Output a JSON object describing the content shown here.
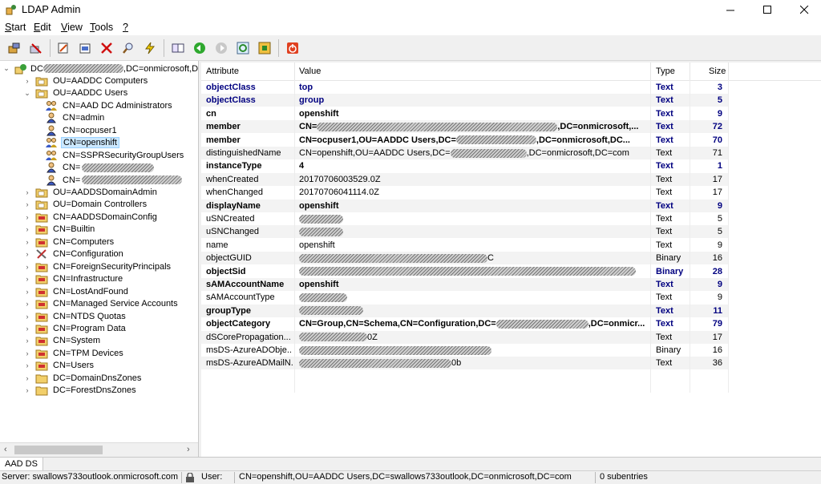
{
  "window": {
    "title": "LDAP Admin",
    "minimize": "—",
    "maximize": "☐",
    "close": "✕"
  },
  "menu": [
    {
      "label": "Start",
      "u": "S",
      "rest": "tart"
    },
    {
      "label": "Edit",
      "u": "E",
      "rest": "dit"
    },
    {
      "label": "View",
      "u": "V",
      "rest": "iew"
    },
    {
      "label": "Tools",
      "u": "T",
      "rest": "ools"
    },
    {
      "label": "?",
      "u": "?",
      "rest": ""
    }
  ],
  "toolbar_icons": [
    "connect-icon",
    "disconnect-icon",
    "edit-entry-icon",
    "properties-icon",
    "delete-icon",
    "search-icon",
    "quick-search-icon",
    "schema-icon",
    "back-icon",
    "forward-icon",
    "refresh-icon",
    "export-icon",
    "exit-icon"
  ],
  "tree": {
    "root": {
      "label_prefix": "DC",
      "label_suffix": ",DC=onmicrosoft,D"
    },
    "items": [
      {
        "label": "OU=AADDC Computers",
        "icon": "ou-folder-icon",
        "expanded": false
      },
      {
        "label": "OU=AADDC Users",
        "icon": "ou-folder-icon",
        "expanded": true
      },
      {
        "label": "CN=AAD DC Administrators",
        "icon": "group-icon",
        "child": true
      },
      {
        "label": "CN=admin",
        "icon": "user-icon",
        "child": true
      },
      {
        "label": "CN=ocpuser1",
        "icon": "user-icon",
        "child": true
      },
      {
        "label": "CN=openshift",
        "icon": "group-icon",
        "child": true,
        "selected": true
      },
      {
        "label": "CN=SSPRSecurityGroupUsers",
        "icon": "group-icon",
        "child": true
      },
      {
        "label": "CN=",
        "icon": "user-icon",
        "child": true,
        "redacted": 90
      },
      {
        "label": "CN=",
        "icon": "user-icon",
        "child": true,
        "redacted": 125
      },
      {
        "label": "OU=AADDSDomainAdmin",
        "icon": "ou-folder-icon"
      },
      {
        "label": "OU=Domain Controllers",
        "icon": "ou-folder-icon"
      },
      {
        "label": "CN=AADDSDomainConfig",
        "icon": "container-icon"
      },
      {
        "label": "CN=Builtin",
        "icon": "container-icon"
      },
      {
        "label": "CN=Computers",
        "icon": "container-icon"
      },
      {
        "label": "CN=Configuration",
        "icon": "config-icon"
      },
      {
        "label": "CN=ForeignSecurityPrincipals",
        "icon": "container-icon"
      },
      {
        "label": "CN=Infrastructure",
        "icon": "container-icon"
      },
      {
        "label": "CN=LostAndFound",
        "icon": "container-icon"
      },
      {
        "label": "CN=Managed Service Accounts",
        "icon": "container-icon"
      },
      {
        "label": "CN=NTDS Quotas",
        "icon": "container-icon"
      },
      {
        "label": "CN=Program Data",
        "icon": "container-icon"
      },
      {
        "label": "CN=System",
        "icon": "container-icon"
      },
      {
        "label": "CN=TPM Devices",
        "icon": "container-icon"
      },
      {
        "label": "CN=Users",
        "icon": "container-icon"
      },
      {
        "label": "DC=DomainDnsZones",
        "icon": "folder-icon"
      },
      {
        "label": "DC=ForestDnsZones",
        "icon": "folder-icon"
      }
    ]
  },
  "grid": {
    "headers": {
      "attribute": "Attribute",
      "value": "Value",
      "type": "Type",
      "size": "Size"
    },
    "rows": [
      {
        "attr": "objectClass",
        "value": "top",
        "type": "Text",
        "size": "3",
        "style": "oc"
      },
      {
        "attr": "objectClass",
        "value": "group",
        "type": "Text",
        "size": "5",
        "style": "oc"
      },
      {
        "attr": "cn",
        "value": "openshift",
        "type": "Text",
        "size": "9",
        "style": "bold"
      },
      {
        "attr": "member",
        "value": "CN=",
        "tail": ",DC=onmicrosoft,...",
        "redact": 300,
        "type": "Text",
        "size": "72",
        "style": "bold"
      },
      {
        "attr": "member",
        "value": "CN=ocpuser1,OU=AADDC Users,DC=",
        "tail": ",DC=onmicrosoft,DC...",
        "redact": 100,
        "type": "Text",
        "size": "70",
        "style": "bold"
      },
      {
        "attr": "distinguishedName",
        "value": "CN=openshift,OU=AADDC Users,DC=",
        "tail": ",DC=onmicrosoft,DC=com",
        "redact": 95,
        "type": "Text",
        "size": "71",
        "style": ""
      },
      {
        "attr": "instanceType",
        "value": "4",
        "type": "Text",
        "size": "1",
        "style": "bold"
      },
      {
        "attr": "whenCreated",
        "value": "20170706003529.0Z",
        "type": "Text",
        "size": "17",
        "style": ""
      },
      {
        "attr": "whenChanged",
        "value": "20170706041114.0Z",
        "type": "Text",
        "size": "17",
        "style": ""
      },
      {
        "attr": "displayName",
        "value": "openshift",
        "type": "Text",
        "size": "9",
        "style": "bold"
      },
      {
        "attr": "uSNCreated",
        "value": "",
        "redact": 55,
        "type": "Text",
        "size": "5",
        "style": ""
      },
      {
        "attr": "uSNChanged",
        "value": "",
        "redact": 55,
        "type": "Text",
        "size": "5",
        "style": ""
      },
      {
        "attr": "name",
        "value": "openshift",
        "type": "Text",
        "size": "9",
        "style": ""
      },
      {
        "attr": "objectGUID",
        "value": "",
        "redact": 235,
        "tail": "C",
        "type": "Binary",
        "size": "16",
        "style": ""
      },
      {
        "attr": "objectSid",
        "value": "",
        "redact": 420,
        "type": "Binary",
        "size": "28",
        "style": "bold"
      },
      {
        "attr": "sAMAccountName",
        "value": "openshift",
        "type": "Text",
        "size": "9",
        "style": "bold"
      },
      {
        "attr": "sAMAccountType",
        "value": "",
        "redact": 60,
        "type": "Text",
        "size": "9",
        "style": ""
      },
      {
        "attr": "groupType",
        "value": "",
        "redact": 80,
        "type": "Text",
        "size": "11",
        "style": "bold"
      },
      {
        "attr": "objectCategory",
        "value": "CN=Group,CN=Schema,CN=Configuration,DC=",
        "tail": ",DC=onmicr...",
        "redact": 115,
        "type": "Text",
        "size": "79",
        "style": "bold"
      },
      {
        "attr": "dSCorePropagation...",
        "value": "",
        "redact": 85,
        "tail": "0Z",
        "type": "Text",
        "size": "17",
        "style": ""
      },
      {
        "attr": "msDS-AzureADObje...",
        "value": "",
        "redact": 240,
        "type": "Binary",
        "size": "16",
        "style": ""
      },
      {
        "attr": "msDS-AzureADMailN...",
        "value": "",
        "redact": 190,
        "tail": "0b",
        "type": "Text",
        "size": "36",
        "style": ""
      }
    ]
  },
  "tab": {
    "label": "AAD DS"
  },
  "status": {
    "server": "Server: swallows733outlook.onmicrosoft.com",
    "user_label": "User:",
    "user_dn": "CN=openshift,OU=AADDC Users,DC=swallows733outlook,DC=onmicrosoft,DC=com",
    "subentries": "0 subentries"
  }
}
